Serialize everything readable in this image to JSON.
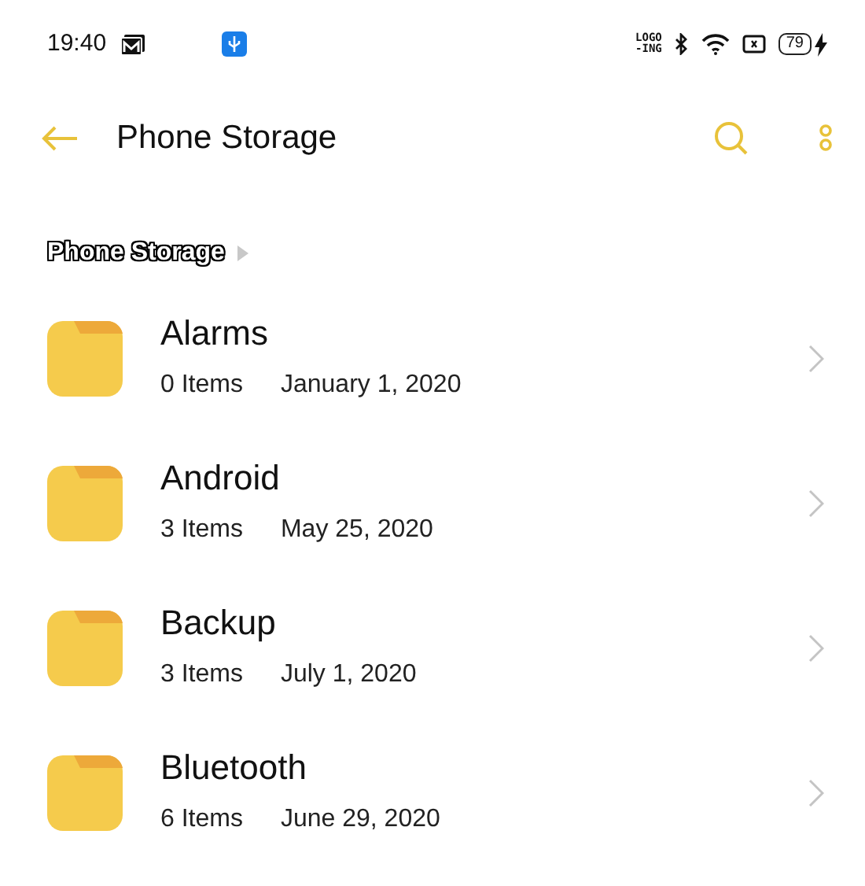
{
  "status_bar": {
    "time": "19:40",
    "network_label": [
      "LOGO",
      "-ING"
    ],
    "battery": "79"
  },
  "toolbar": {
    "title": "Phone Storage"
  },
  "breadcrumb": [
    {
      "label": "Phone Storage"
    }
  ],
  "folders": [
    {
      "name": "Alarms",
      "count": "0 Items",
      "date": "January 1, 2020"
    },
    {
      "name": "Android",
      "count": "3 Items",
      "date": "May 25, 2020"
    },
    {
      "name": "Backup",
      "count": "3 Items",
      "date": "July 1, 2020"
    },
    {
      "name": "Bluetooth",
      "count": "6 Items",
      "date": "June 29, 2020"
    }
  ]
}
